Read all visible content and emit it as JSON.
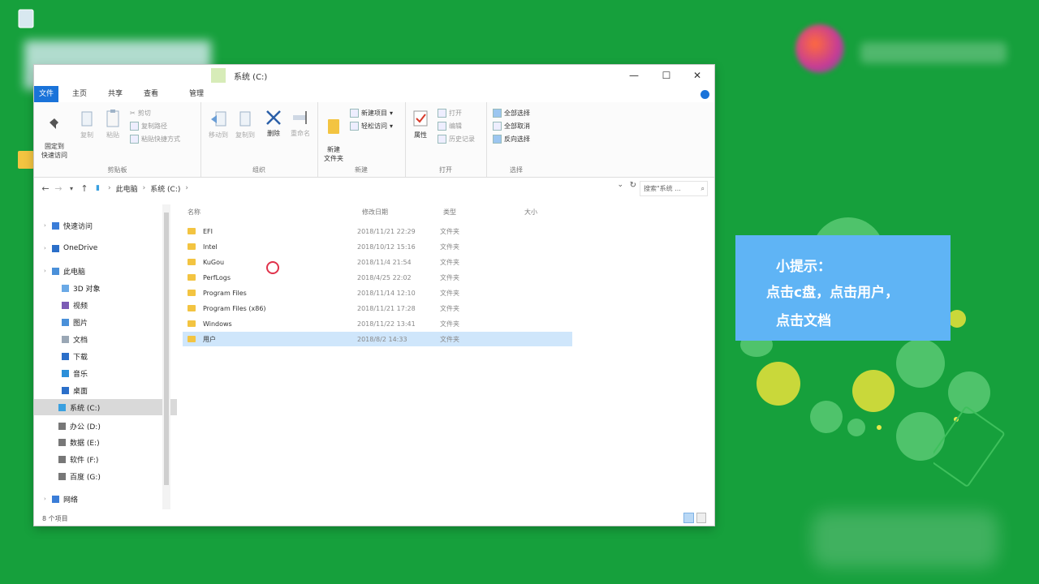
{
  "window": {
    "title": "系统 (C:)",
    "controls": {
      "minimize": "—",
      "maximize": "☐",
      "close": "✕"
    }
  },
  "ribbon_tabs": [
    "文件",
    "主页",
    "共享",
    "查看",
    "管理"
  ],
  "ribbon": {
    "clipboard": {
      "pin": "固定到\n快速访问",
      "copy": "复制",
      "paste": "粘贴",
      "cut": "剪切",
      "copy_path": "复制路径",
      "paste_shortcut": "粘贴快捷方式",
      "label": "剪贴板"
    },
    "organize": {
      "move_to": "移动到",
      "copy_to": "复制到",
      "delete": "删除",
      "rename": "重命名",
      "label": "组织"
    },
    "new": {
      "new_folder": "新建\n文件夹",
      "new_item": "新建项目",
      "easy_access": "轻松访问",
      "label": "新建"
    },
    "open": {
      "properties": "属性",
      "open": "打开",
      "edit": "编辑",
      "history": "历史记录",
      "label": "打开"
    },
    "select": {
      "select_all": "全部选择",
      "select_none": "全部取消",
      "invert": "反向选择",
      "label": "选择"
    }
  },
  "address": {
    "crumbs": [
      "此电脑",
      "系统 (C:)"
    ],
    "search_placeholder": "搜索\"系统 ..."
  },
  "nav_pane": [
    {
      "label": "快速访问",
      "icon": "star-icon",
      "color": "#3b7dd8"
    },
    {
      "label": "OneDrive",
      "icon": "cloud-icon",
      "color": "#2b6fc9"
    },
    {
      "label": "此电脑",
      "icon": "computer-icon",
      "color": "#4a90d9"
    },
    {
      "label": "3D 对象",
      "icon": "cube-icon",
      "color": "#6aa9e6"
    },
    {
      "label": "视频",
      "icon": "video-icon",
      "color": "#7b5bb5"
    },
    {
      "label": "图片",
      "icon": "picture-icon",
      "color": "#4a90d9"
    },
    {
      "label": "文档",
      "icon": "document-icon",
      "color": "#9aa7b5"
    },
    {
      "label": "下载",
      "icon": "download-icon",
      "color": "#2b6fc9"
    },
    {
      "label": "音乐",
      "icon": "music-icon",
      "color": "#2b8fd9"
    },
    {
      "label": "桌面",
      "icon": "desktop-icon",
      "color": "#2b6fc9"
    },
    {
      "label": "系统 (C:)",
      "icon": "drive-c-icon",
      "color": "#3aa0e0"
    },
    {
      "label": "办公 (D:)",
      "icon": "drive-icon",
      "color": "#777777"
    },
    {
      "label": "数据 (E:)",
      "icon": "drive-icon",
      "color": "#777777"
    },
    {
      "label": "软件 (F:)",
      "icon": "drive-icon",
      "color": "#777777"
    },
    {
      "label": "百度 (G:)",
      "icon": "drive-icon",
      "color": "#777777"
    },
    {
      "label": "网络",
      "icon": "network-icon",
      "color": "#3b7dd8"
    }
  ],
  "columns": {
    "name": "名称",
    "date": "修改日期",
    "type": "类型",
    "size": "大小"
  },
  "files": [
    {
      "name": "EFI",
      "date": "2018/11/21 22:29",
      "type": "文件夹"
    },
    {
      "name": "Intel",
      "date": "2018/10/12 15:16",
      "type": "文件夹"
    },
    {
      "name": "KuGou",
      "date": "2018/11/4 21:54",
      "type": "文件夹"
    },
    {
      "name": "PerfLogs",
      "date": "2018/4/25 22:02",
      "type": "文件夹"
    },
    {
      "name": "Program Files",
      "date": "2018/11/14 12:10",
      "type": "文件夹"
    },
    {
      "name": "Program Files (x86)",
      "date": "2018/11/21 17:28",
      "type": "文件夹"
    },
    {
      "name": "Windows",
      "date": "2018/11/22 13:41",
      "type": "文件夹"
    },
    {
      "name": "用户",
      "date": "2018/8/2 14:33",
      "type": "文件夹"
    }
  ],
  "status": {
    "item_count": "8 个项目"
  },
  "tip": {
    "title": "小提示：",
    "line1": "点击c盘，点击用户，",
    "line2": "点击文档"
  },
  "colors": {
    "desktop": "#16a03c",
    "accent": "#1a73d9",
    "tip_bg": "#5fb4f5",
    "selection": "#cfe6fb"
  }
}
